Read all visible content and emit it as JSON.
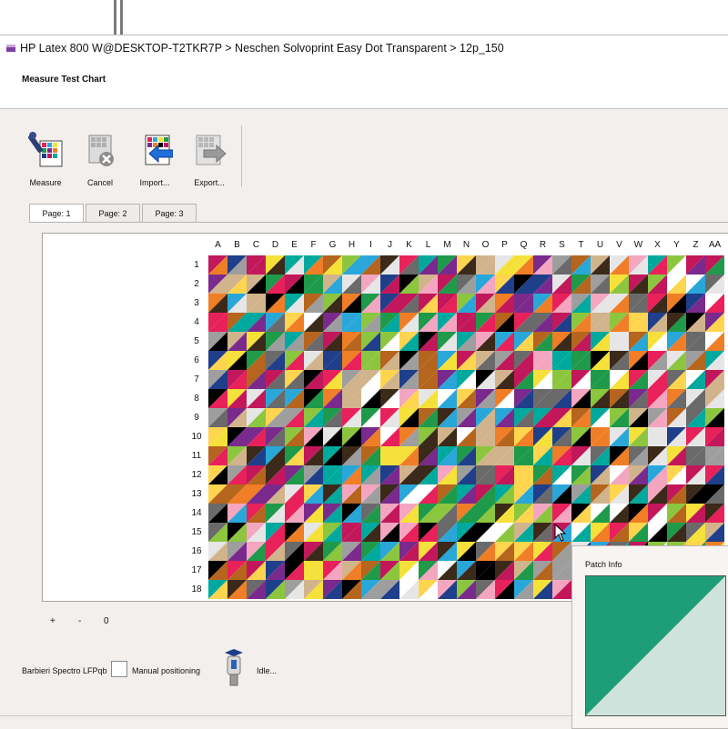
{
  "window": {
    "breadcrumb": "HP Latex 800 W@DESKTOP-T2TKR7P > Neschen Solvoprint Easy Dot Transparent > 12p_150",
    "title": "Measure Test Chart"
  },
  "toolbar": {
    "measure_label": "Measure",
    "cancel_label": "Cancel",
    "import_label": "Import...",
    "export_label": "Export..."
  },
  "tabs": [
    "Page: 1",
    "Page: 2",
    "Page: 3"
  ],
  "chart": {
    "columns": [
      "A",
      "B",
      "C",
      "D",
      "E",
      "F",
      "G",
      "H",
      "I",
      "J",
      "K",
      "L",
      "M",
      "N",
      "O",
      "P",
      "Q",
      "R",
      "S",
      "T",
      "U",
      "V",
      "W",
      "X",
      "Y",
      "Z",
      "AA"
    ],
    "rows": [
      "1",
      "2",
      "3",
      "4",
      "5",
      "6",
      "7",
      "8",
      "9",
      "10",
      "11",
      "12",
      "13",
      "14",
      "15",
      "16",
      "17",
      "18"
    ],
    "palette": [
      "#000000",
      "#ffffff",
      "#e8215a",
      "#f5e13a",
      "#2aa7d9",
      "#1f9a4a",
      "#f07e26",
      "#7a2a8c",
      "#d2b48c",
      "#6a6a6a",
      "#f4a6c1",
      "#8cc63f",
      "#1f3f8a",
      "#c2185b",
      "#00a99d",
      "#b5651d",
      "#e6e6e6",
      "#3b2a1a",
      "#ffd54f",
      "#9e9e9e"
    ]
  },
  "zoom": {
    "plus": "+",
    "minus": "-",
    "value": "0"
  },
  "status": {
    "device": "Barbieri Spectro LFPqb",
    "manual_positioning": "Manual positioning",
    "idle": "Idle..."
  },
  "patch_info": {
    "title": "Patch Info",
    "color_a": "#1e9e78",
    "color_b": "#cfe3dc"
  }
}
